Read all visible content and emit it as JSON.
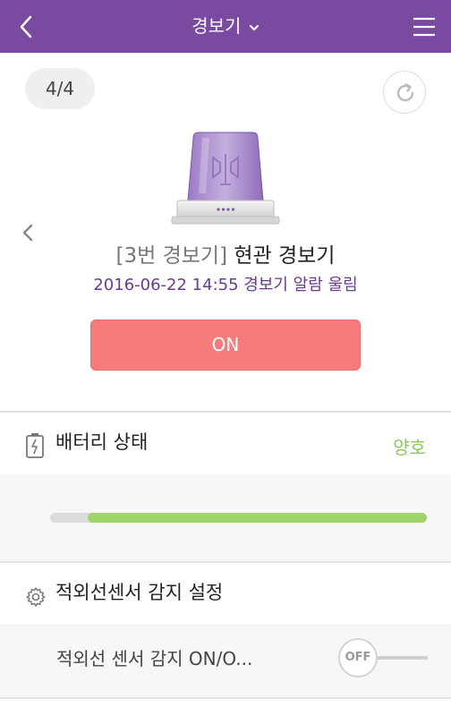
{
  "header": {
    "title": "경보기",
    "bg_color": "#7a4aa0",
    "back_icon": "chevron-left-icon",
    "dropdown_icon": "chevron-down-icon",
    "menu_icon": "hamburger-menu-icon"
  },
  "pager": {
    "label": "4/4"
  },
  "refresh": {
    "icon": "refresh-icon"
  },
  "device": {
    "icon": "siren-icon",
    "number_label": "[3번 경보기]",
    "name": "현관 경보기",
    "alarm_time": "2016-06-22 14:55",
    "alarm_text": "경보기 알람 울림",
    "power_button_label": "ON",
    "power_button_color": "#f67b7b"
  },
  "battery": {
    "icon": "battery-icon",
    "label": "배터리 상태",
    "status": "양호",
    "status_color": "#8ac75a",
    "level_percent": 90
  },
  "sensor": {
    "icon": "gear-icon",
    "section_label": "적외선센서 감지 설정",
    "toggle_label": "적외선 센서 감지 ON/O...",
    "toggle_state": "OFF"
  }
}
